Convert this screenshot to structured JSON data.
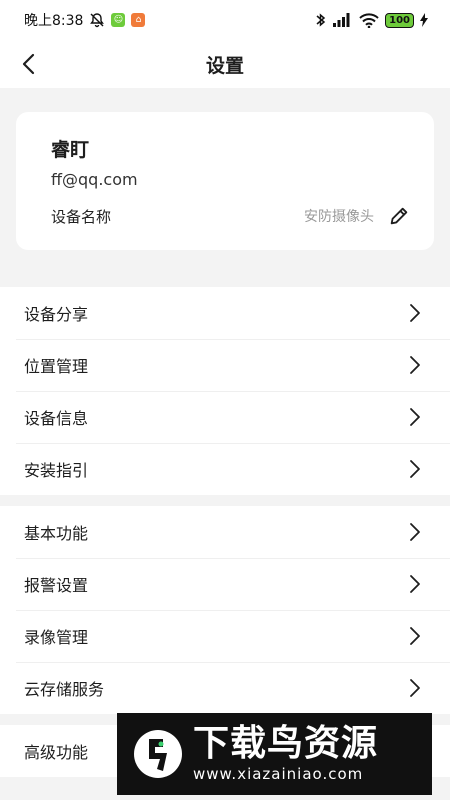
{
  "status_bar": {
    "time": "晚上8:38",
    "battery": "100",
    "icons": [
      "bell-off-icon",
      "app-icon-green",
      "app-icon-orange",
      "bluetooth-icon",
      "signal-icon",
      "wifi-icon",
      "charging-icon"
    ]
  },
  "header": {
    "title": "设置",
    "back_icon": "chevron-left-icon"
  },
  "device_card": {
    "name": "睿盯",
    "email": "ff@qq.com",
    "device_name_label": "设备名称",
    "device_name_value": "安防摄像头",
    "edit_icon": "pencil-icon"
  },
  "groups": [
    {
      "items": [
        {
          "label": "设备分享"
        },
        {
          "label": "位置管理"
        },
        {
          "label": "设备信息"
        },
        {
          "label": "安装指引"
        }
      ]
    },
    {
      "items": [
        {
          "label": "基本功能"
        },
        {
          "label": "报警设置"
        },
        {
          "label": "录像管理"
        },
        {
          "label": "云存储服务"
        }
      ]
    },
    {
      "items": [
        {
          "label": "高级功能"
        }
      ]
    }
  ],
  "watermark": {
    "title": "下载鸟资源",
    "url": "www.xiazainiao.com"
  },
  "colors": {
    "background": "#f3f3f3",
    "card": "#ffffff",
    "muted_text": "#9a9a9a",
    "battery_fill": "#6ecb3b"
  }
}
